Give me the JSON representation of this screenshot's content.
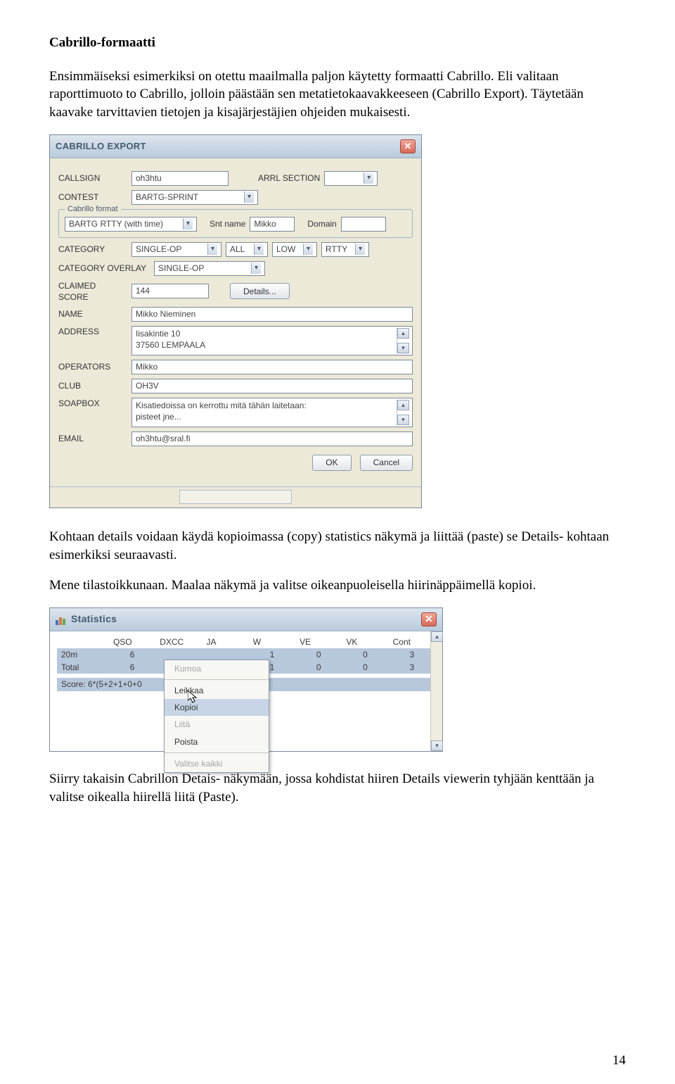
{
  "doc": {
    "heading": "Cabrillo-formaatti",
    "para1": "Ensimmäiseksi esimerkiksi on otettu maailmalla paljon käytetty formaatti Cabrillo. Eli valitaan raporttimuoto to Cabrillo, jolloin päästään sen metatietokaavakkeeseen (Cabrillo Export). Täytetään kaavake tarvittavien tietojen ja kisajärjestäjien ohjeiden mukaisesti.",
    "para2": "Kohtaan details voidaan käydä kopioimassa (copy) statistics näkymä ja liittää (paste) se Details- kohtaan esimerkiksi seuraavasti.",
    "para3": "Mene tilastoikkunaan. Maalaa näkymä ja valitse oikeanpuoleisella hiirinäppäimellä kopioi.",
    "para4": "Siirry takaisin Cabrillon Detais- näkymään, jossa kohdistat hiiren Details viewerin tyhjään kenttään ja valitse oikealla hiirellä liitä (Paste).",
    "page_number": "14"
  },
  "export": {
    "title": "CABRILLO EXPORT",
    "labels": {
      "callsign": "CALLSIGN",
      "arrl_section": "ARRL SECTION",
      "contest": "CONTEST",
      "cabrillo_format_group": "Cabrillo format",
      "snt_name": "Snt name",
      "domain": "Domain",
      "category": "CATEGORY",
      "category_overlay": "CATEGORY OVERLAY",
      "claimed_score": "CLAIMED SCORE",
      "details_btn": "Details...",
      "name": "NAME",
      "address": "ADDRESS",
      "operators": "OPERATORS",
      "club": "CLUB",
      "soapbox": "SOAPBOX",
      "email": "EMAIL",
      "ok": "OK",
      "cancel": "Cancel"
    },
    "values": {
      "callsign": "oh3htu",
      "arrl_section": "",
      "contest": "BARTG-SPRINT",
      "cabrillo_format": "BARTG RTTY (with time)",
      "snt_name": "Mikko",
      "domain": "",
      "category_main": "SINGLE-OP",
      "category_band": "ALL",
      "category_power": "LOW",
      "category_mode": "RTTY",
      "category_overlay": "SINGLE-OP",
      "claimed_score": "144",
      "name": "Mikko Nieminen",
      "address": "Iisakintie 10\n37560 LEMPAALA",
      "operators": "Mikko",
      "club": "OH3V",
      "soapbox": "Kisatiedoissa on kerrottu mitä tähän laitetaan:\npisteet jne...",
      "email": "oh3htu@sral.fi"
    }
  },
  "stats": {
    "title": "Statistics",
    "headers": [
      "",
      "QSO",
      "DXCC",
      "JA",
      "W",
      "VE",
      "VK",
      "Cont"
    ],
    "rows": [
      {
        "label": "20m",
        "values": [
          "6",
          "",
          "",
          "1",
          "0",
          "0",
          "3"
        ]
      },
      {
        "label": "Total",
        "values": [
          "6",
          "",
          "",
          "1",
          "0",
          "0",
          "3"
        ]
      }
    ],
    "score_line": "Score: 6*(5+2+1+0+0",
    "menu": {
      "kumoa": "Kumoa",
      "leikkaa": "Leikkaa",
      "kopioi": "Kopioi",
      "liita": "Liitä",
      "poista": "Poista",
      "valitse_kaikki": "Valitse kaikki"
    }
  }
}
